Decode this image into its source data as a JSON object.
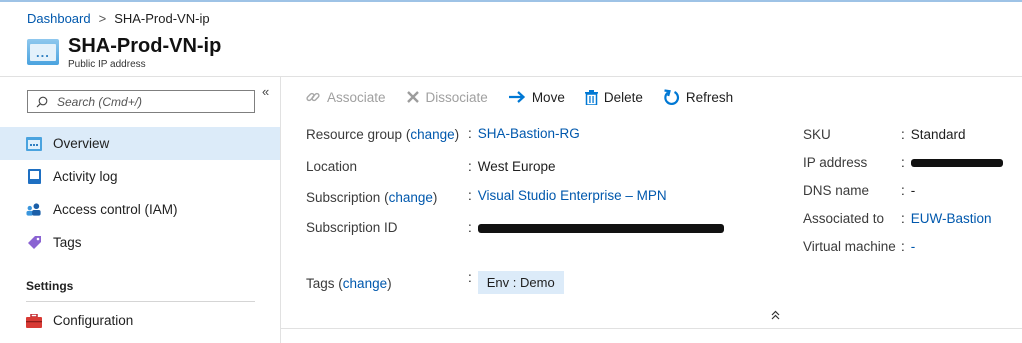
{
  "breadcrumb": {
    "root": "Dashboard",
    "separator": ">",
    "current": "SHA-Prod-VN-ip"
  },
  "resource": {
    "name": "SHA-Prod-VN-ip",
    "type": "Public IP address"
  },
  "search": {
    "placeholder": "Search (Cmd+/)"
  },
  "collapse_label": "«",
  "sidebar": {
    "items": [
      {
        "label": "Overview",
        "icon": "overview-icon",
        "active": true
      },
      {
        "label": "Activity log",
        "icon": "activity-log-icon"
      },
      {
        "label": "Access control (IAM)",
        "icon": "iam-icon"
      },
      {
        "label": "Tags",
        "icon": "tag-icon"
      }
    ],
    "section_settings": "Settings",
    "settings_items": [
      {
        "label": "Configuration",
        "icon": "toolbox-icon"
      }
    ]
  },
  "toolbar": {
    "associate": "Associate",
    "dissociate": "Dissociate",
    "move": "Move",
    "delete": "Delete",
    "refresh": "Refresh"
  },
  "essentials": {
    "resource_group_label": "Resource group",
    "change_label": "change",
    "resource_group_value": "SHA-Bastion-RG",
    "location_label": "Location",
    "location_value": "West Europe",
    "subscription_label": "Subscription",
    "subscription_value": "Visual Studio Enterprise – MPN",
    "subscription_id_label": "Subscription ID",
    "tags_label": "Tags",
    "tag_value": "Env : Demo",
    "sku_label": "SKU",
    "sku_value": "Standard",
    "ip_label": "IP address",
    "dns_label": "DNS name",
    "dns_value": "-",
    "associated_label": "Associated to",
    "associated_value": "EUW-Bastion",
    "vm_label": "Virtual machine",
    "vm_value": "-",
    "colon": ":",
    "paren_open": "(",
    "paren_close": ")"
  },
  "collapse_essentials_label": "≈",
  "colors": {
    "accent": "#0078d4",
    "link": "#0058ad",
    "selected_bg": "#dcebf9",
    "disabled": "#a0a0a0"
  }
}
